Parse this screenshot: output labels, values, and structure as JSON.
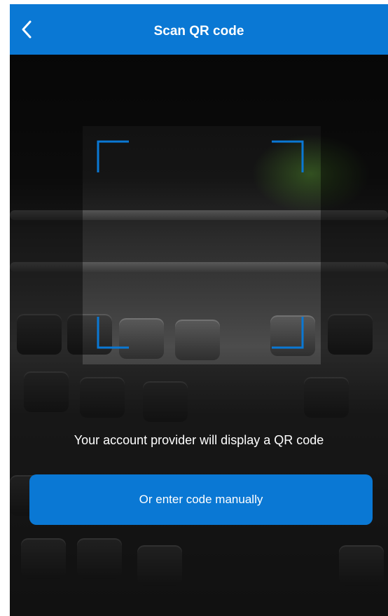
{
  "header": {
    "title": "Scan QR code",
    "back_icon": "chevron-left-icon",
    "background": "#0a78d4"
  },
  "scanner": {
    "frame_color": "#0a78d4",
    "instruction": "Your account provider will display a QR code"
  },
  "actions": {
    "manual_label": "Or enter code manually",
    "background": "#0a78d4"
  }
}
